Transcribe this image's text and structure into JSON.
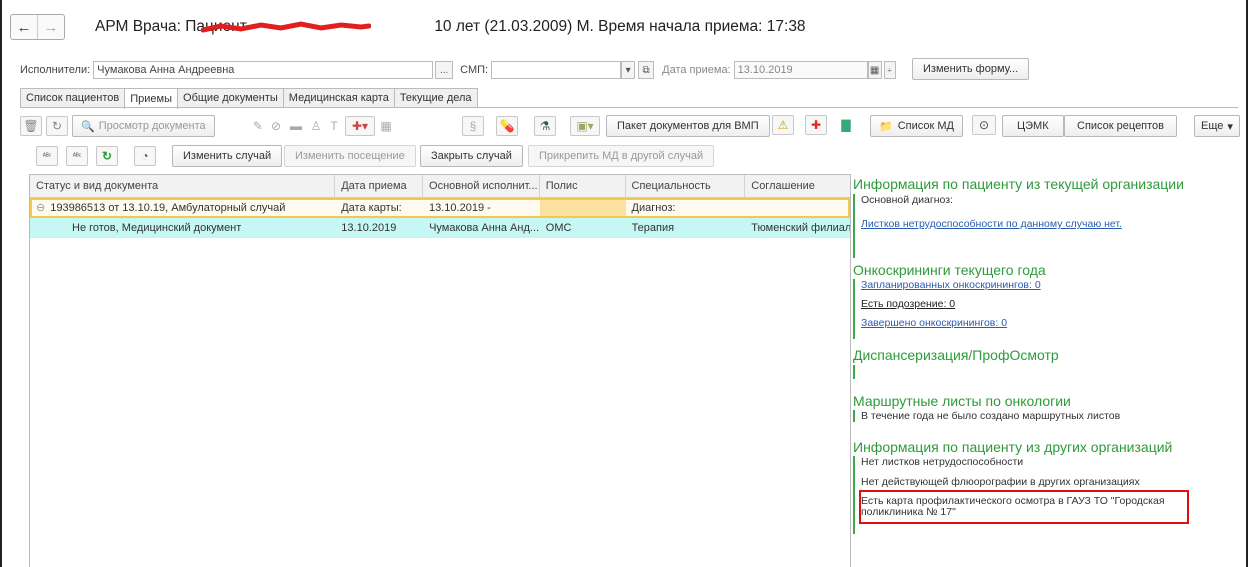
{
  "window": {
    "back_glyph": "←",
    "forward_glyph": "→",
    "title_prefix": "АРМ Врача: Пациент -",
    "title_suffix": "10 лет  (21.03.2009) М. Время начала приема: 17:38"
  },
  "filters": {
    "performer_label": "Исполнители:",
    "performer_value": "Чумакова Анна Андреевна",
    "performer_btn": "...",
    "smp_label": "СМП:",
    "smp_value": "",
    "date_label": "Дата приема:",
    "date_value": "13.10.2019",
    "change_form_btn": "Изменить форму..."
  },
  "tabs": [
    "Список пациентов",
    "Приемы",
    "Общие документы",
    "Медицинская карта",
    "Текущие дела"
  ],
  "toolbar1": {
    "view_doc": "Просмотр документа",
    "package_vmp": "Пакет документов для ВМП",
    "list_md": "Список МД",
    "cemk": "ЦЭМК",
    "recipes": "Список рецептов",
    "more": "Еще"
  },
  "toolbar2": {
    "change_case": "Изменить случай",
    "change_visit": "Изменить посещение",
    "close_case": "Закрыть случай",
    "attach_md": "Прикрепить МД в другой случай"
  },
  "grid": {
    "columns": [
      "Статус и вид документа",
      "Дата приема",
      "Основной исполнит...",
      "Полис",
      "Специальность",
      "Соглашение"
    ],
    "rows": [
      [
        "193986513 от 13.10.19, Амбулаторный случай",
        "Дата карты:",
        "13.10.2019 -",
        "",
        "Диагноз:",
        ""
      ],
      [
        "Не готов, Медицинский документ",
        "13.10.2019",
        "Чумакова Анна Анд...",
        "ОМС",
        "Терапия",
        "Тюменский филиал"
      ]
    ]
  },
  "right_panel": {
    "s1_title": "Информация по пациенту из текущей организации",
    "s1_diag": "Основной диагноз:",
    "s1_link": "Листков нетрудоспособности по данному случаю нет.",
    "s2_title": "Онкоскрининги текущего года",
    "s2_planned": "Запланированных онкоскринингов: 0",
    "s2_suspect": "Есть подозрение: 0",
    "s2_done": "Завершено онкоскринингов: 0",
    "s3_title": "Диспансеризация/ПрофОсмотр",
    "s4_title": "Маршрутные листы по онкологии",
    "s4_text": "В течение года не было создано маршрутных листов",
    "s5_title": "Информация по пациенту из других организаций",
    "s5_l1": "Нет листков нетрудоспособности",
    "s5_l2": "Нет действующей флюорографии в других организациях",
    "s5_l3a": "Есть карта профилактического осмотра в ГАУЗ ТО \"Городская",
    "s5_l3b": "поликлиника № 17\""
  }
}
